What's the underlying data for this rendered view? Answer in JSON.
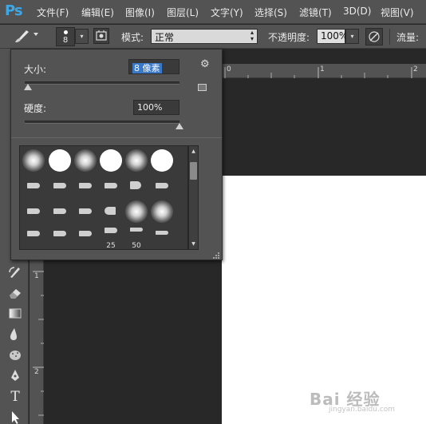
{
  "app": {
    "logo": "Ps"
  },
  "menu": {
    "items": [
      {
        "label": "文件(F)"
      },
      {
        "label": "编辑(E)"
      },
      {
        "label": "图像(I)"
      },
      {
        "label": "图层(L)"
      },
      {
        "label": "文字(Y)"
      },
      {
        "label": "选择(S)"
      },
      {
        "label": "滤镜(T)"
      },
      {
        "label": "3D(D)"
      },
      {
        "label": "视图(V)"
      }
    ]
  },
  "options_bar": {
    "brush_size": "8",
    "mode_label": "模式:",
    "mode_value": "正常",
    "opacity_label": "不透明度:",
    "opacity_value": "100%",
    "flow_label": "流量:"
  },
  "brush_picker": {
    "size_label": "大小:",
    "size_value": "8 像素",
    "size_level": 0.02,
    "hardness_label": "硬度:",
    "hardness_value": "100%",
    "hardness_level": 1.0,
    "brush_labels": {
      "size_25": "25",
      "size_50": "50"
    }
  },
  "rulers": {
    "horizontal": [
      "0",
      "1",
      "2"
    ],
    "vertical": [
      "1",
      "2"
    ]
  },
  "watermark": {
    "text": "Bai 经验",
    "sub": "jingyan.baidu.com"
  },
  "colors": {
    "accent": "#3da7e8",
    "panel": "#535353",
    "workspace": "#282828",
    "selection": "#3a78c8"
  }
}
